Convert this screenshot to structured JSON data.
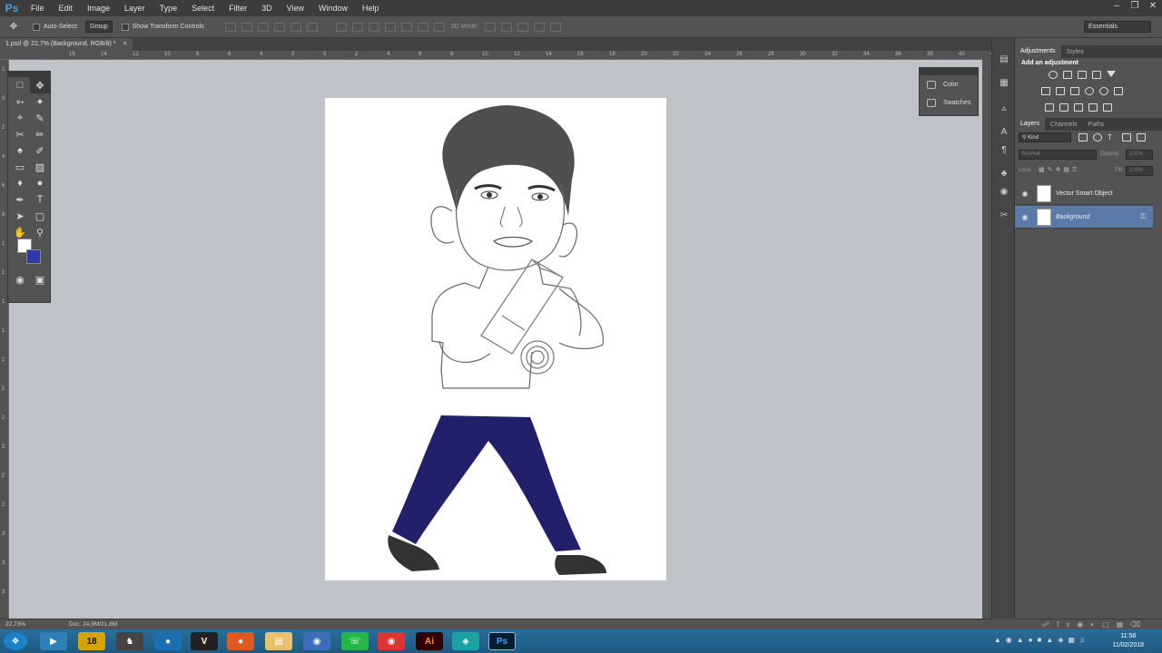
{
  "app": {
    "logo": "Ps"
  },
  "menu": [
    "File",
    "Edit",
    "Image",
    "Layer",
    "Type",
    "Select",
    "Filter",
    "3D",
    "View",
    "Window",
    "Help"
  ],
  "options": {
    "auto_select": "Auto-Select:",
    "auto_select_value": "Group",
    "transform_controls": "Show Transform Controls",
    "mode3d": "3D Mode:",
    "workspace": "Essentials"
  },
  "document": {
    "tab_title": "1.psd @ 22,7% (Background, RGB/8) *"
  },
  "rulers": {
    "top": [
      "16",
      "14",
      "12",
      "10",
      "8",
      "6",
      "4",
      "2",
      "0",
      "2",
      "4",
      "6",
      "8",
      "10",
      "12",
      "14",
      "16",
      "18",
      "20",
      "22",
      "24",
      "26",
      "28",
      "30",
      "32",
      "34",
      "36",
      "38",
      "40",
      "42"
    ],
    "left": [
      "2",
      "0",
      "2",
      "4",
      "6",
      "8",
      "1",
      "1",
      "1",
      "1",
      "1",
      "2",
      "2",
      "2",
      "2",
      "2",
      "3",
      "3",
      "3"
    ]
  },
  "mini_panel": {
    "items": [
      {
        "label": "Color"
      },
      {
        "label": "Swatches"
      }
    ]
  },
  "adjustments": {
    "tabs": [
      "Adjustments",
      "Styles"
    ],
    "title": "Add an adjustment"
  },
  "layers": {
    "tabs": [
      "Layers",
      "Channels",
      "Paths"
    ],
    "filter": "Kind",
    "blend_mode": "Normal",
    "opacity_label": "Opacity:",
    "opacity_value": "100%",
    "lock_label": "Lock:",
    "fill_label": "Fill:",
    "fill_value": "100%",
    "items": [
      {
        "name": "Vector Smart Object",
        "selected": false
      },
      {
        "name": "Background",
        "selected": true
      }
    ]
  },
  "status": {
    "zoom": "22,73%",
    "doc": "Doc: 24,9M/21,8M"
  },
  "taskbar": {
    "time": "11:58",
    "date": "11/02/2018",
    "items": [
      "18",
      "Ai",
      "Ps"
    ]
  },
  "colors": {
    "foreground": "#ffffff",
    "background": "#2f3aa8",
    "pants": "#221f6b",
    "hair": "#4f4f4f"
  }
}
